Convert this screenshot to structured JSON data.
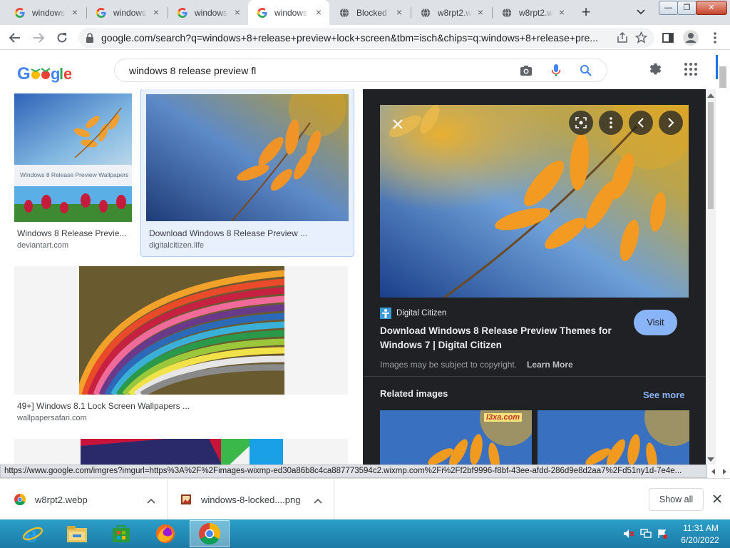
{
  "tabs": [
    {
      "label": "windows",
      "icon": "google-g-icon"
    },
    {
      "label": "windows",
      "icon": "google-g-icon"
    },
    {
      "label": "windows",
      "icon": "google-g-icon"
    },
    {
      "label": "windows",
      "icon": "google-g-icon",
      "active": true
    },
    {
      "label": "Blocked",
      "icon": "globe-icon"
    },
    {
      "label": "w8rpt2.w",
      "icon": "globe-icon"
    },
    {
      "label": "w8rpt2.w",
      "icon": "globe-icon"
    }
  ],
  "window_controls": {
    "minimize": "—",
    "restore": "❐",
    "close": "✕"
  },
  "address_bar": {
    "url": "google.com/search?q=windows+8+release+preview+lock+screen&tbm=isch&chips=q:windows+8+release+pre..."
  },
  "search": {
    "query": "windows 8 release preview fl"
  },
  "results": [
    {
      "title": "Windows 8 Release Previe...",
      "source": "deviantart.com",
      "image_caption": "Windows 8 Release Preview Wallpapers"
    },
    {
      "title": "Download Windows 8 Release Preview ...",
      "source": "digitalcitizen.life"
    },
    {
      "title": "49+] Windows 8.1 Lock Screen Wallpapers ...",
      "source": "wallpapersafari.com"
    }
  ],
  "panel": {
    "site": "Digital Citizen",
    "title_line1": "Download Windows 8 Release Preview Themes for",
    "title_line2": "Windows 7 | Digital Citizen",
    "copyright": "Images may be subject to copyright.",
    "learn_more": "Learn More",
    "visit": "Visit",
    "related": "Related images",
    "see_more": "See more",
    "related_watermark": "l3xa.com"
  },
  "status_url": "https://www.google.com/imgres?imgurl=https%3A%2F%2Fimages-wixmp-ed30a86b8c4ca887773594c2.wixmp.com%2Fi%2Ff2bf9996-f8bf-43ee-afdd-286d9e8d2aa7%2Fd51ny1d-7e4e...",
  "downloads": {
    "items": [
      {
        "name": "w8rpt2.webp"
      },
      {
        "name": "windows-8-locked....png"
      }
    ],
    "show_all": "Show all"
  },
  "clock": {
    "time": "11:31 AM",
    "date": "6/20/2022"
  },
  "colors": {
    "google_blue": "#1a73e8",
    "panel_bg": "#202124",
    "visit_btn": "#8ab4f8",
    "taskbar": "#1b7aa6"
  }
}
